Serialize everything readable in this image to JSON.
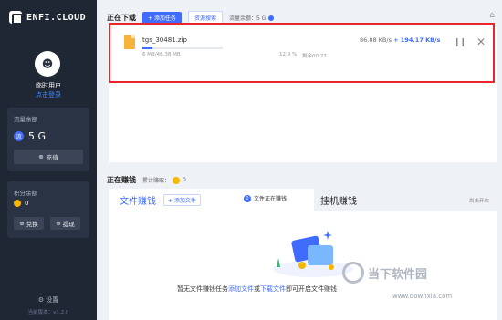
{
  "brand": "ENFI.CLOUD",
  "user": {
    "name": "临时用户",
    "login_link": "点击登录"
  },
  "flow_panel": {
    "title": "流量余额",
    "icon": "流",
    "value": "5 G",
    "recharge_label": "充值"
  },
  "points_panel": {
    "title": "积分余额",
    "value": "0",
    "exchange_label": "兑换",
    "withdraw_label": "提现"
  },
  "settings_label": "设置",
  "version": "当前版本：v1.2.0",
  "download": {
    "title": "正在下载",
    "add_task_label": "+ 添加任务",
    "resource_search_label": "资源搜索",
    "flow_left_label": "流量余额：5 G",
    "task": {
      "file_name": "tgs_30481.zip",
      "size": "6 MB/46.38 MB",
      "percent": "12.9 %",
      "remaining": "剩余00:27",
      "speed_a": "86.88 KB/s",
      "speed_b": "+ 194.17 KB/s",
      "progress": 0.129
    }
  },
  "earn": {
    "title": "正在赚钱",
    "total_label": "累计赚取：",
    "total_value": "0",
    "tab_files": "文件赚钱",
    "add_file_label": "+ 添加文件",
    "earning_tag": "文件正在赚钱",
    "tab_idle": "挂机赚钱",
    "off_text": "尚未开启",
    "empty_prefix": "暂无文件赚钱任务",
    "empty_link1": "添加文件",
    "empty_mid": "或",
    "empty_link2": "下载文件",
    "empty_suffix": "即可开启文件赚钱"
  },
  "watermark": {
    "text": "当下软件园",
    "url": "www.downxia.com"
  },
  "colors": {
    "accent": "#3f6bff",
    "sidebar": "#1f2634",
    "highlight": "#e8262b"
  }
}
